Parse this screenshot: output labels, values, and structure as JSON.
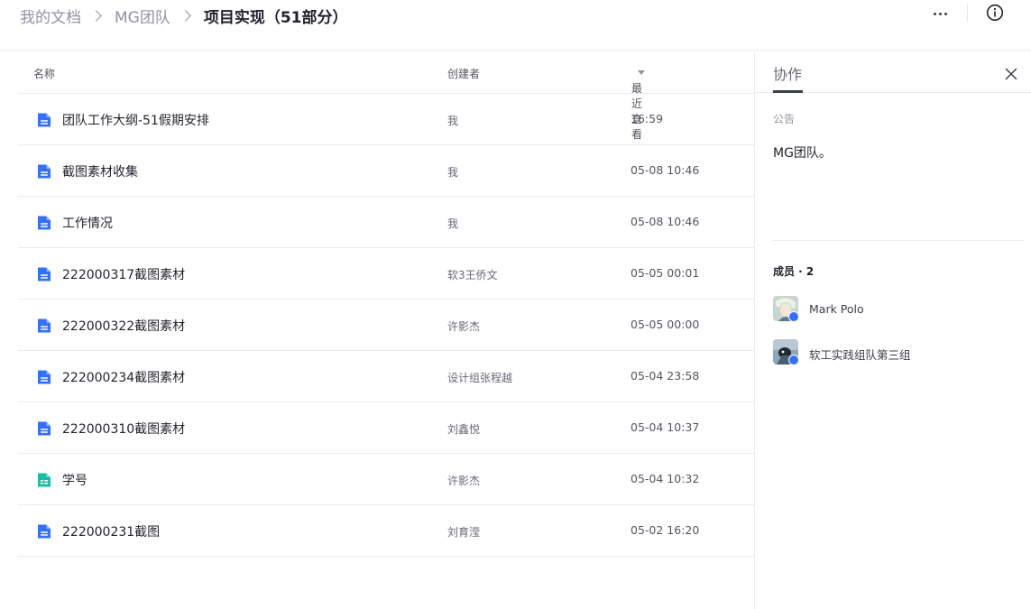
{
  "breadcrumb": {
    "items": [
      "我的文档",
      "MG团队"
    ],
    "current": "项目实现（51部分）"
  },
  "toolbar": {
    "more_icon": "more-horizontal-icon",
    "info_icon": "info-circle-icon"
  },
  "file_list": {
    "headers": {
      "name": "名称",
      "creator": "创建者",
      "last_viewed": "最近查看"
    },
    "rows": [
      {
        "name": "团队工作大纲-51假期安排",
        "creator": "我",
        "time": "16:59",
        "type": "doc"
      },
      {
        "name": "截图素材收集",
        "creator": "我",
        "time": "05-08 10:46",
        "type": "doc"
      },
      {
        "name": "工作情况",
        "creator": "我",
        "time": "05-08 10:46",
        "type": "doc"
      },
      {
        "name": "222000317截图素材",
        "creator": "软3王侨文",
        "time": "05-05 00:01",
        "type": "doc"
      },
      {
        "name": "222000322截图素材",
        "creator": "许影杰",
        "time": "05-05 00:00",
        "type": "doc"
      },
      {
        "name": "222000234截图素材",
        "creator": "设计组张程越",
        "time": "05-04 23:58",
        "type": "doc"
      },
      {
        "name": "222000310截图素材",
        "creator": "刘鑫悦",
        "time": "05-04 10:37",
        "type": "doc"
      },
      {
        "name": "学号",
        "creator": "许影杰",
        "time": "05-04 10:32",
        "type": "sheet"
      },
      {
        "name": "222000231截图",
        "creator": "刘育滢",
        "time": "05-02 16:20",
        "type": "doc"
      }
    ]
  },
  "panel": {
    "tab": "协作",
    "notice_label": "公告",
    "notice_text": "MG团队。",
    "members_title": "成员 · 2",
    "members": [
      {
        "name": "Mark Polo"
      },
      {
        "name": "软工实践组队第三组"
      }
    ]
  },
  "colors": {
    "doc_icon": "#3370ff",
    "sheet_icon": "#14c0a0",
    "accent_tab": "#3a3f47"
  }
}
